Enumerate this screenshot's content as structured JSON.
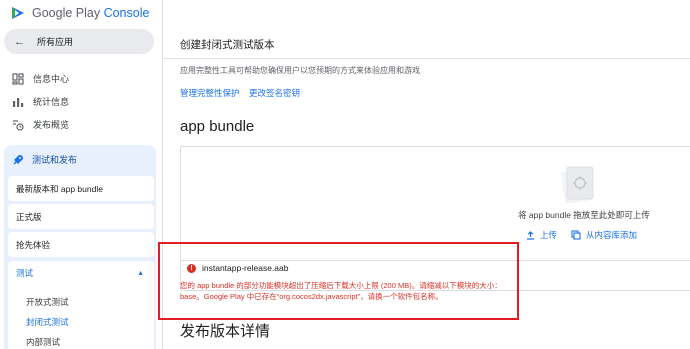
{
  "brand": {
    "name_prefix": "Google Play ",
    "name_suffix": "Console",
    "colors": {
      "blue": "#1a73e8",
      "green": "#34a853",
      "red": "#d93025"
    }
  },
  "sidebar": {
    "back_label": "所有应用",
    "items": [
      {
        "label": "信息中心",
        "icon": "dashboard-icon"
      },
      {
        "label": "统计信息",
        "icon": "bar-chart-icon"
      },
      {
        "label": "发布概览",
        "icon": "publish-overview-icon"
      }
    ],
    "release_section": {
      "label": "测试和发布",
      "icon": "rocket-icon",
      "cards": [
        "最新版本和 app bundle",
        "正式版",
        "抢先体验"
      ],
      "testing": {
        "label": "测试",
        "sub_items": [
          "开放式测试",
          "封闭式测试",
          "内部测试"
        ],
        "active": "封闭式测试"
      }
    }
  },
  "main": {
    "title": "创建封闭式测试版本",
    "description": "应用完整性工具可帮助您确保用户以您预期的方式来体验应用和游戏",
    "links": [
      "管理完整性保护",
      "更改签名密钥"
    ],
    "section_title": "app bundle",
    "upload": {
      "drop_text": "将 app bundle 拖放至此处即可上传",
      "upload_label": "上传",
      "library_label": "从内容库添加"
    },
    "file": {
      "name": "instantapp-release.aab",
      "error": "您的 app bundle 的部分功能模块超出了压缩后下载大小上限 (200 MB)。请缩减以下模块的大小：base。Google Play 中已存在“org.cocos2dx.javascript”，请换一个软件包名称。"
    },
    "details_title": "发布版本详情"
  }
}
